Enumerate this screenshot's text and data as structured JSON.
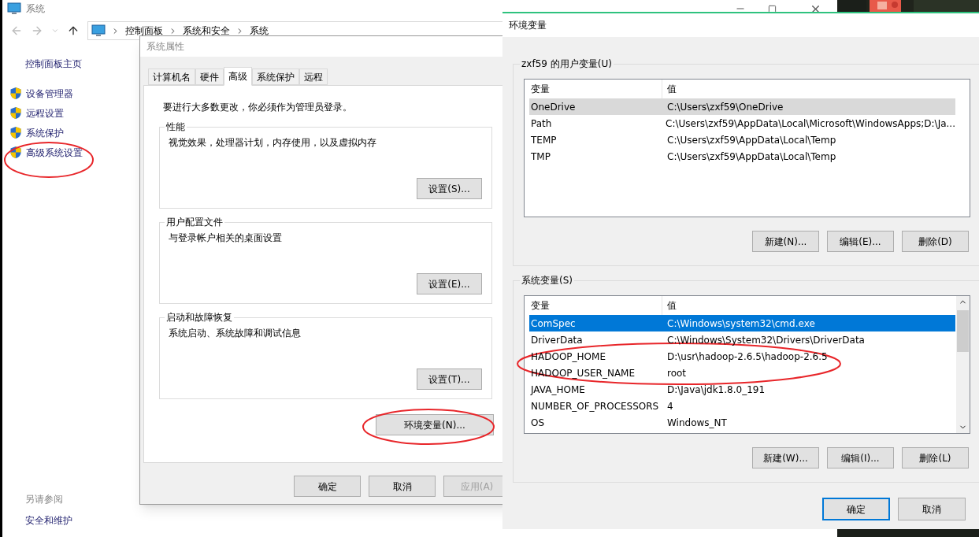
{
  "system_window": {
    "title": "系统",
    "breadcrumb": [
      "控制面板",
      "系统和安全",
      "系统"
    ],
    "sidebar_home": "控制面板主页",
    "sidebar_items": [
      "设备管理器",
      "远程设置",
      "系统保护",
      "高级系统设置"
    ],
    "see_also": {
      "heading": "另请参阅",
      "links": [
        "安全和维护"
      ]
    }
  },
  "system_properties": {
    "title": "系统属性",
    "tabs": [
      {
        "label": "计算机名",
        "selected": false
      },
      {
        "label": "硬件",
        "selected": false
      },
      {
        "label": "高级",
        "selected": true
      },
      {
        "label": "系统保护",
        "selected": false
      },
      {
        "label": "远程",
        "selected": false
      }
    ],
    "notice": "要进行大多数更改，你必须作为管理员登录。",
    "groups": [
      {
        "title": "性能",
        "description": "视觉效果，处理器计划，内存使用，以及虚拟内存",
        "button": "设置(S)..."
      },
      {
        "title": "用户配置文件",
        "description": "与登录帐户相关的桌面设置",
        "button": "设置(E)..."
      },
      {
        "title": "启动和故障恢复",
        "description": "系统启动、系统故障和调试信息",
        "button": "设置(T)..."
      }
    ],
    "env_button": "环境变量(N)...",
    "buttons": [
      {
        "label": "确定",
        "disabled": false
      },
      {
        "label": "取消",
        "disabled": false
      },
      {
        "label": "应用(A)",
        "disabled": true
      }
    ]
  },
  "environment_variables": {
    "title": "环境变量",
    "sections": [
      {
        "title": "zxf59 的用户变量(U)",
        "columns": [
          "变量",
          "值"
        ],
        "focused": false,
        "scrollable": false,
        "rows": [
          {
            "name": "OneDrive",
            "value": "C:\\Users\\zxf59\\OneDrive",
            "selected": true
          },
          {
            "name": "Path",
            "value": "C:\\Users\\zxf59\\AppData\\Local\\Microsoft\\WindowsApps;D:\\Ja...",
            "selected": false
          },
          {
            "name": "TEMP",
            "value": "C:\\Users\\zxf59\\AppData\\Local\\Temp",
            "selected": false
          },
          {
            "name": "TMP",
            "value": "C:\\Users\\zxf59\\AppData\\Local\\Temp",
            "selected": false
          }
        ],
        "buttons": [
          "新建(N)...",
          "编辑(E)...",
          "删除(D)"
        ]
      },
      {
        "title": "系统变量(S)",
        "columns": [
          "变量",
          "值"
        ],
        "focused": true,
        "scrollable": true,
        "rows": [
          {
            "name": "ComSpec",
            "value": "C:\\Windows\\system32\\cmd.exe",
            "selected": true
          },
          {
            "name": "DriverData",
            "value": "C:\\Windows\\System32\\Drivers\\DriverData",
            "selected": false
          },
          {
            "name": "HADOOP_HOME",
            "value": "D:\\usr\\hadoop-2.6.5\\hadoop-2.6.5",
            "selected": false
          },
          {
            "name": "HADOOP_USER_NAME",
            "value": "root",
            "selected": false
          },
          {
            "name": "JAVA_HOME",
            "value": "D:\\Java\\jdk1.8.0_191",
            "selected": false
          },
          {
            "name": "NUMBER_OF_PROCESSORS",
            "value": "4",
            "selected": false
          },
          {
            "name": "OS",
            "value": "Windows_NT",
            "selected": false
          }
        ],
        "buttons": [
          "新建(W)...",
          "编辑(I)...",
          "删除(L)"
        ]
      }
    ],
    "buttons": [
      {
        "label": "确定",
        "default": true
      },
      {
        "label": "取消",
        "default": false
      }
    ]
  }
}
